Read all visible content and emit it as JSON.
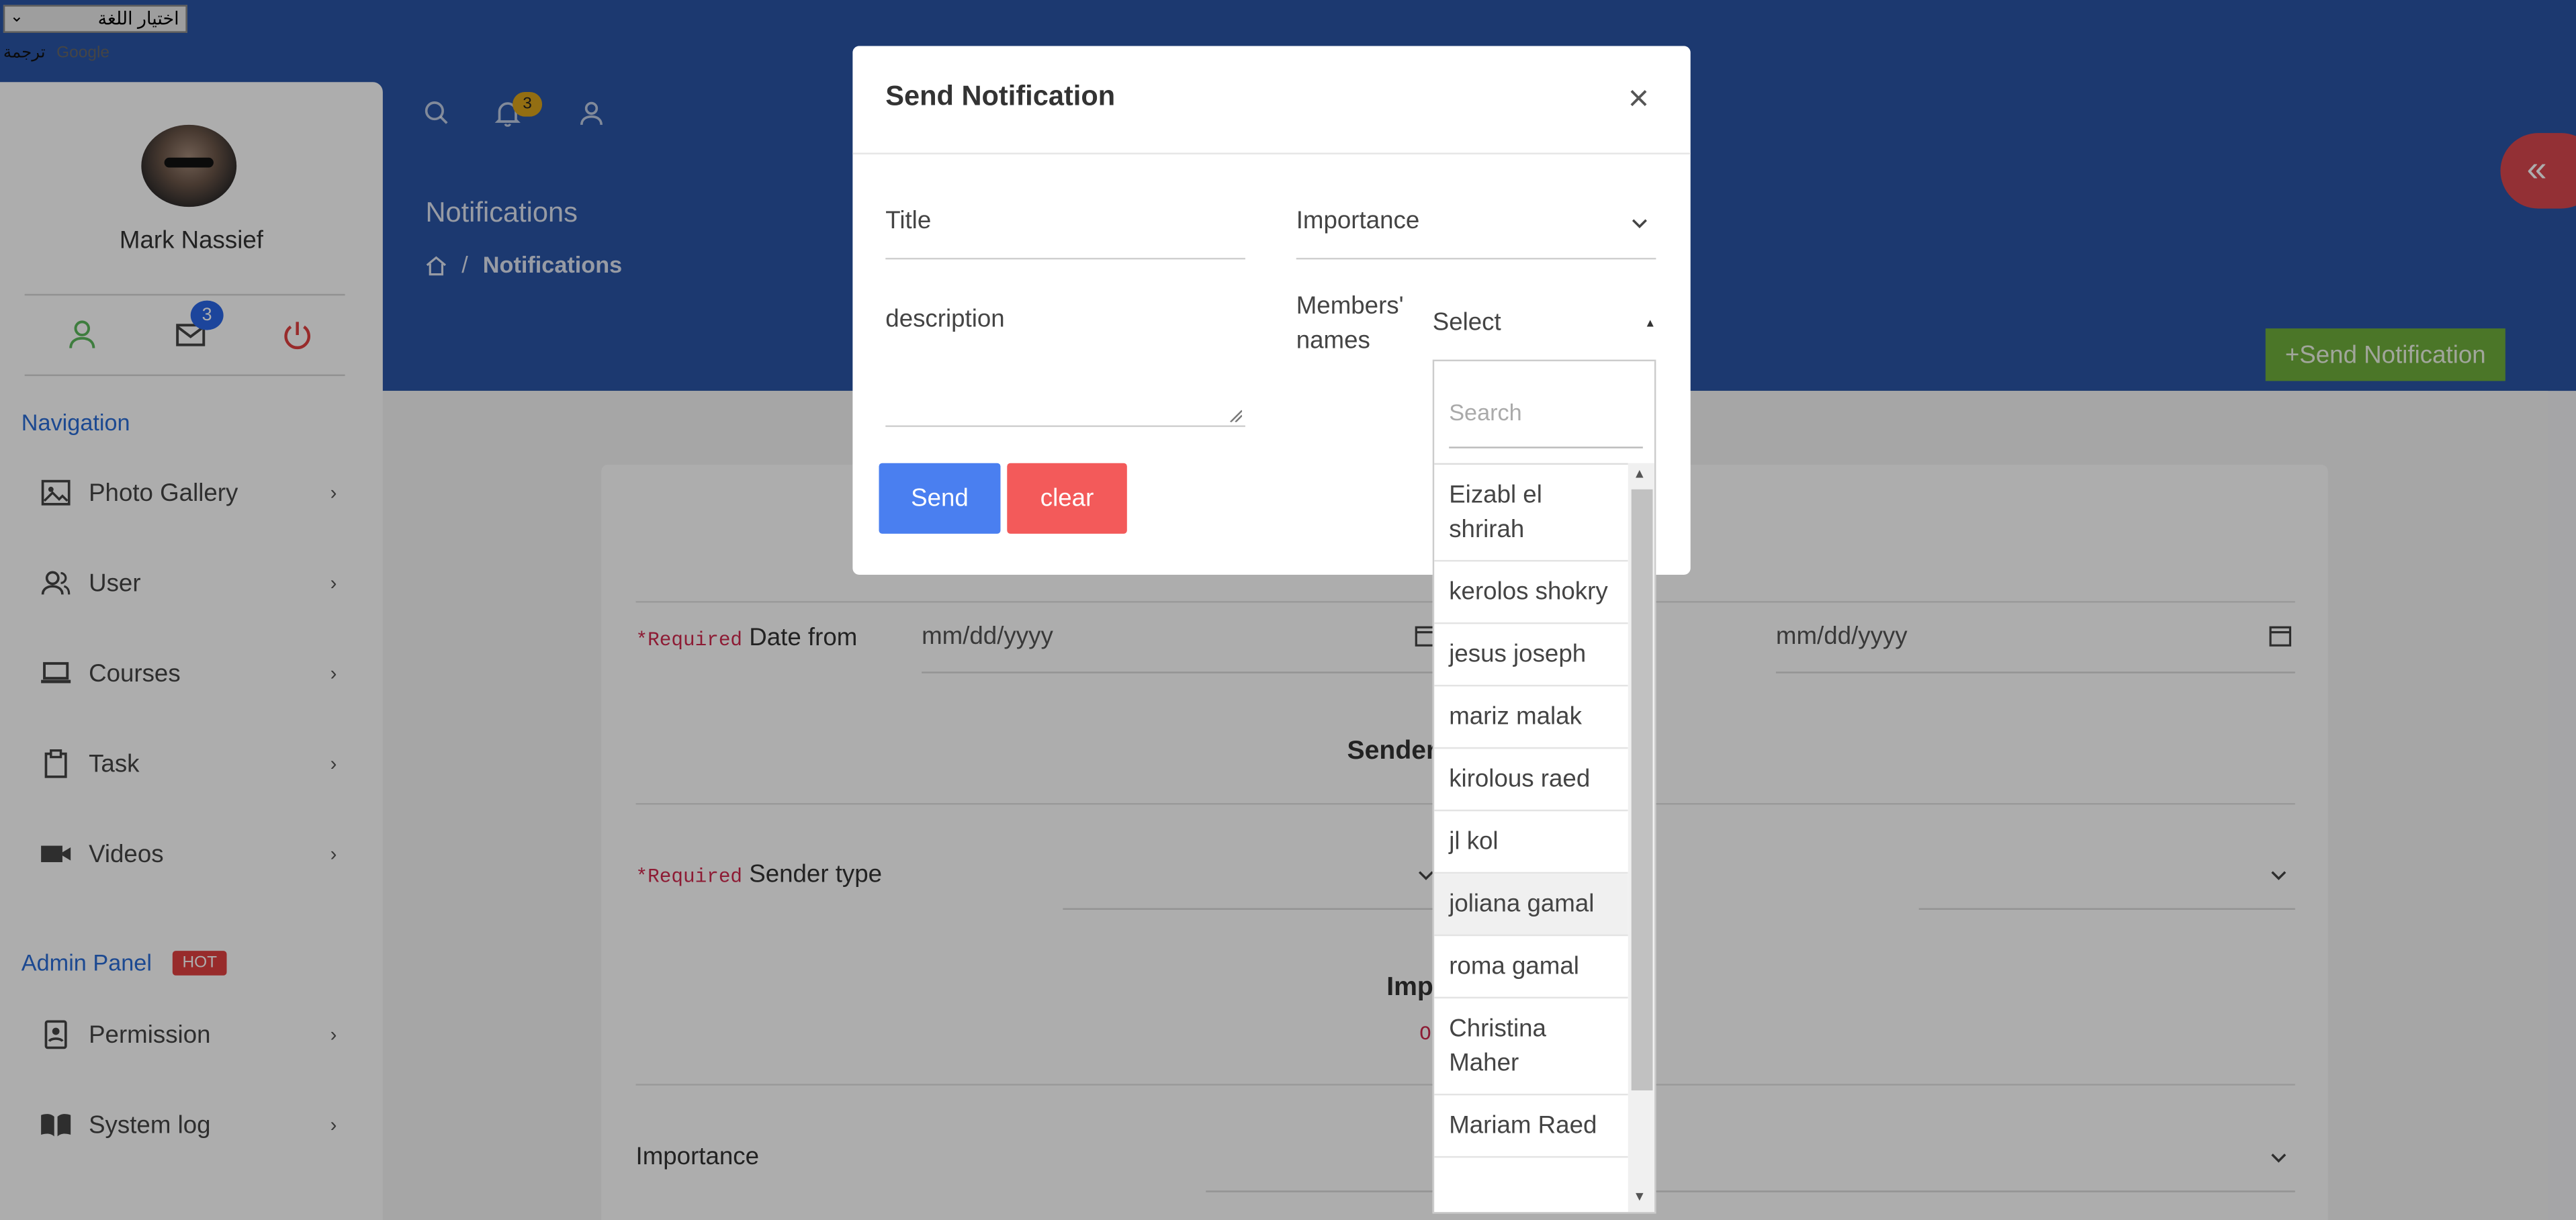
{
  "language": {
    "select_label": "اختيار اللغة",
    "translate_label": "ترجمة",
    "powered_by": "Google"
  },
  "sidebar": {
    "user_name": "Mark Nassief",
    "mail_badge": "3",
    "navigation_title": "Navigation",
    "admin_title": "Admin Panel",
    "hot_badge": "HOT",
    "items": [
      {
        "label": "Photo Gallery",
        "icon": "image-icon"
      },
      {
        "label": "User",
        "icon": "users-icon"
      },
      {
        "label": "Courses",
        "icon": "laptop-icon"
      },
      {
        "label": "Task",
        "icon": "clipboard-icon"
      },
      {
        "label": "Videos",
        "icon": "video-icon"
      }
    ],
    "admin_items": [
      {
        "label": "Permission",
        "icon": "id-badge-icon"
      },
      {
        "label": "System log",
        "icon": "book-icon"
      }
    ]
  },
  "header": {
    "bell_badge": "3",
    "page_title": "Notifications",
    "breadcrumb_current": "Notifications",
    "breadcrumb_sep": "/",
    "send_notification_label": "+Send Notification",
    "collapse_icon": "«"
  },
  "filters": {
    "required_tag": "*Required",
    "date_from_label": "Date from",
    "date_placeholder": "mm/dd/yyyy",
    "sender_heading": "Sender",
    "sender_type_label": "Sender type",
    "importance_heading": "Imp",
    "optional_tag": "Op",
    "importance_label": "Importance"
  },
  "modal": {
    "title": "Send Notification",
    "close": "×",
    "title_field": "Title",
    "importance_field": "Importance",
    "description_field": "description",
    "members_label_1": "Members'",
    "members_label_2": "names",
    "select_value": "Select",
    "send_label": "Send",
    "clear_label": "clear",
    "search_placeholder": "Search",
    "members": [
      "Eizabl el shrirah",
      "kerolos shokry",
      "jesus joseph",
      "mariz malak",
      "kirolous raed",
      "jl kol",
      "joliana gamal",
      "roma gamal",
      "Christina Maher",
      "Mariam Raed"
    ],
    "highlighted_member": "joliana gamal"
  },
  "colors": {
    "header_blue": "#2a54a5",
    "send_green": "#6fae3c",
    "send_blue": "#4a7ff0",
    "clear_red": "#f35a5a",
    "required_red": "#d0294d"
  }
}
